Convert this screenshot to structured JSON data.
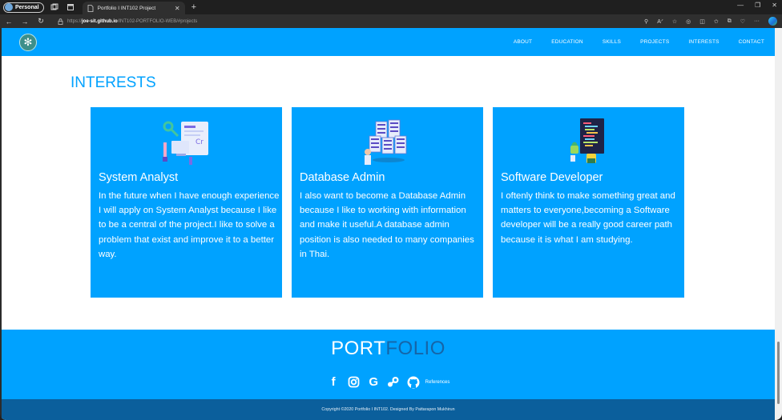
{
  "browser": {
    "profile_label": "Personal",
    "tab_title": "Portfolio I INT102 Project",
    "url_prefix": "https://",
    "url_host": "joe-sit.github.io",
    "url_path": "/INT102-PORTFOLIO-WEB/#projects"
  },
  "site": {
    "nav_items": [
      "ABOUT",
      "EDUCATION",
      "SKILLS",
      "PROJECTS",
      "INTERESTS",
      "CONTACT"
    ],
    "section_title": "INTERESTS",
    "cards": [
      {
        "title": "System Analyst",
        "text": "In the future when I have enough experience I will apply on System Analyst because I like to be a central of the project.I like to solve a problem that exist and improve it to a better way.",
        "icon": "analyst-illustration"
      },
      {
        "title": "Database Admin",
        "text": "I also want to become a Database Admin because I like to working with information and make it useful.A database admin position is also needed to many companies in Thai.",
        "icon": "database-illustration"
      },
      {
        "title": "Software Developer",
        "text": "I oftenly think to make something great and matters to everyone,becoming a Software developer will be a really good career path because it is what I am studying.",
        "icon": "developer-illustration"
      }
    ],
    "footer": {
      "brand_part1": "PORT",
      "brand_part2": "FOLIO",
      "socials": [
        "facebook-icon",
        "instagram-icon",
        "google-icon",
        "steam-icon",
        "github-icon"
      ],
      "references_label": "References",
      "copyright": "Copyright ©2020 Portfolio I INT102. Designed By Pattarapon Mukhirun"
    },
    "colors": {
      "accent": "#00a2ff",
      "brand_dark": "#1565a8",
      "footer_bar": "#0b5f9c"
    }
  }
}
